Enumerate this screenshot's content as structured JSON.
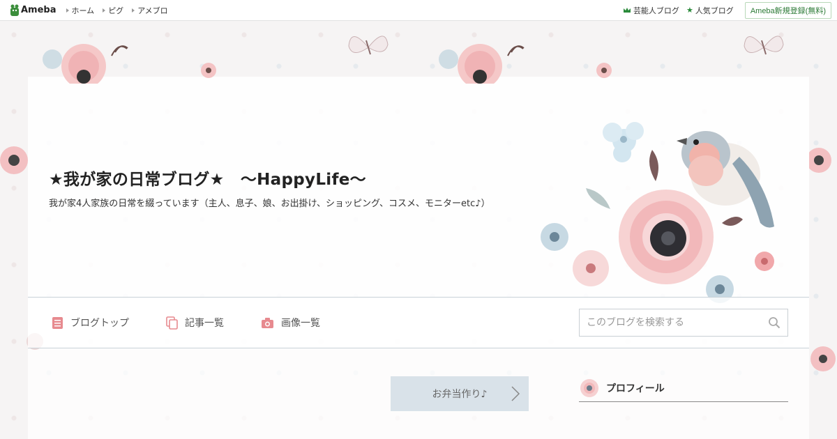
{
  "topbar": {
    "logo_text": "Ameba",
    "nav": [
      "ホーム",
      "ピグ",
      "アメブロ"
    ],
    "links": [
      {
        "label": "芸能人ブログ",
        "icon": "crown-icon"
      },
      {
        "label": "人気ブログ",
        "icon": "star-icon"
      }
    ],
    "register_label": "Ameba新規登録(無料)"
  },
  "header": {
    "title": "★我が家の日常ブログ★　～HappyLife～",
    "description": "我が家4人家族の日常を綴っています（主人、息子、娘、お出掛け、ショッピング、コスメ、モニターetc♪）"
  },
  "nav": {
    "items": [
      {
        "label": "ブログトップ",
        "icon": "document-icon"
      },
      {
        "label": "記事一覧",
        "icon": "copy-icon"
      },
      {
        "label": "画像一覧",
        "icon": "camera-icon"
      }
    ],
    "search_placeholder": "このブログを検索する"
  },
  "entry": {
    "title": "お弁当作り♪"
  },
  "sidebar": {
    "profile_label": "プロフィール"
  },
  "colors": {
    "accent_pink": "#e78a8f",
    "brand_green": "#2c7a36",
    "nav_border": "#c9d2d8"
  }
}
